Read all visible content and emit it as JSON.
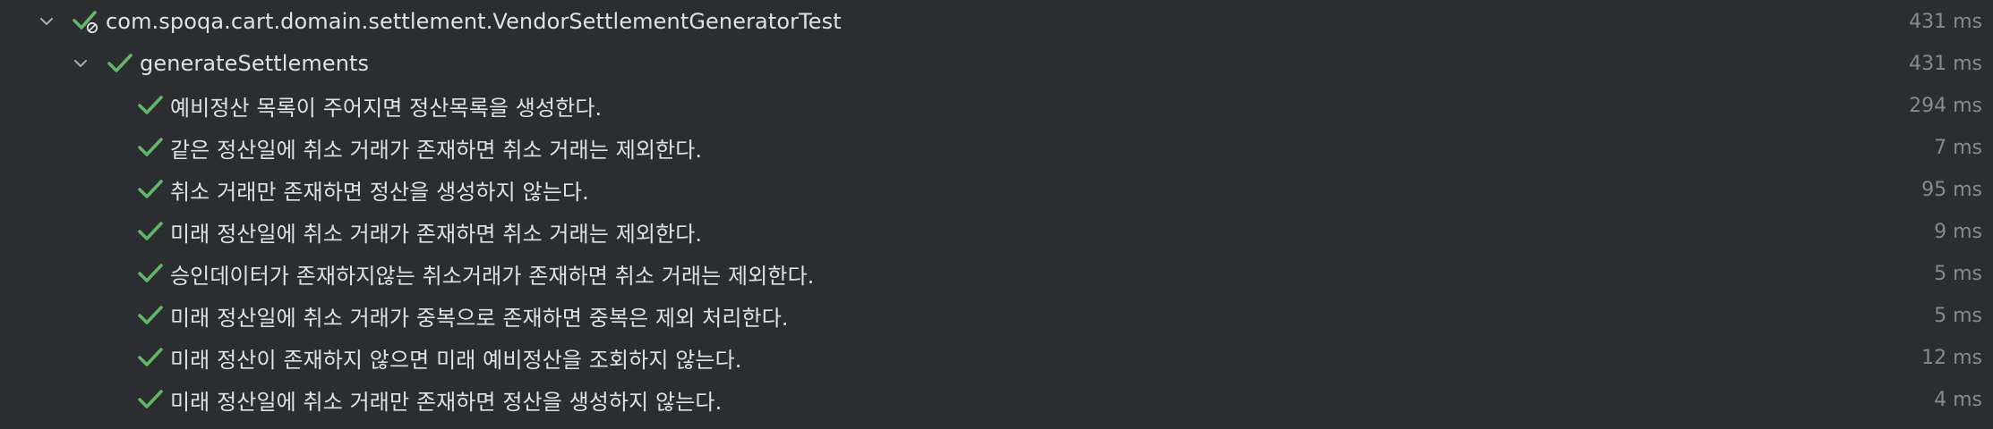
{
  "colors": {
    "background": "#2b2d30",
    "text": "#dfe1e5",
    "duration": "#868a91",
    "pass": "#5fb865",
    "chevron": "#a8adb5"
  },
  "root": {
    "label": "com.spoqa.cart.domain.settlement.VendorSettlementGeneratorTest",
    "duration": "431 ms",
    "icon": "check-with-ignored-icon",
    "expanded": true
  },
  "group": {
    "label": "generateSettlements",
    "duration": "431 ms",
    "icon": "check-icon",
    "expanded": true
  },
  "tests": [
    {
      "label": "예비정산 목록이 주어지면 정산목록을 생성한다.",
      "duration": "294 ms",
      "status": "passed"
    },
    {
      "label": "같은 정산일에 취소 거래가 존재하면 취소 거래는 제외한다.",
      "duration": "7 ms",
      "status": "passed"
    },
    {
      "label": "취소 거래만 존재하면 정산을 생성하지 않는다.",
      "duration": "95 ms",
      "status": "passed"
    },
    {
      "label": "미래 정산일에 취소 거래가 존재하면 취소 거래는 제외한다.",
      "duration": "9 ms",
      "status": "passed"
    },
    {
      "label": "승인데이터가 존재하지않는 취소거래가 존재하면 취소 거래는 제외한다.",
      "duration": "5 ms",
      "status": "passed"
    },
    {
      "label": "미래 정산일에 취소 거래가 중복으로 존재하면 중복은 제외 처리한다.",
      "duration": "5 ms",
      "status": "passed"
    },
    {
      "label": "미래 정산이 존재하지 않으면 미래 예비정산을 조회하지 않는다.",
      "duration": "12 ms",
      "status": "passed"
    },
    {
      "label": "미래 정산일에 취소 거래만 존재하면 정산을 생성하지 않는다.",
      "duration": "4 ms",
      "status": "passed"
    }
  ]
}
